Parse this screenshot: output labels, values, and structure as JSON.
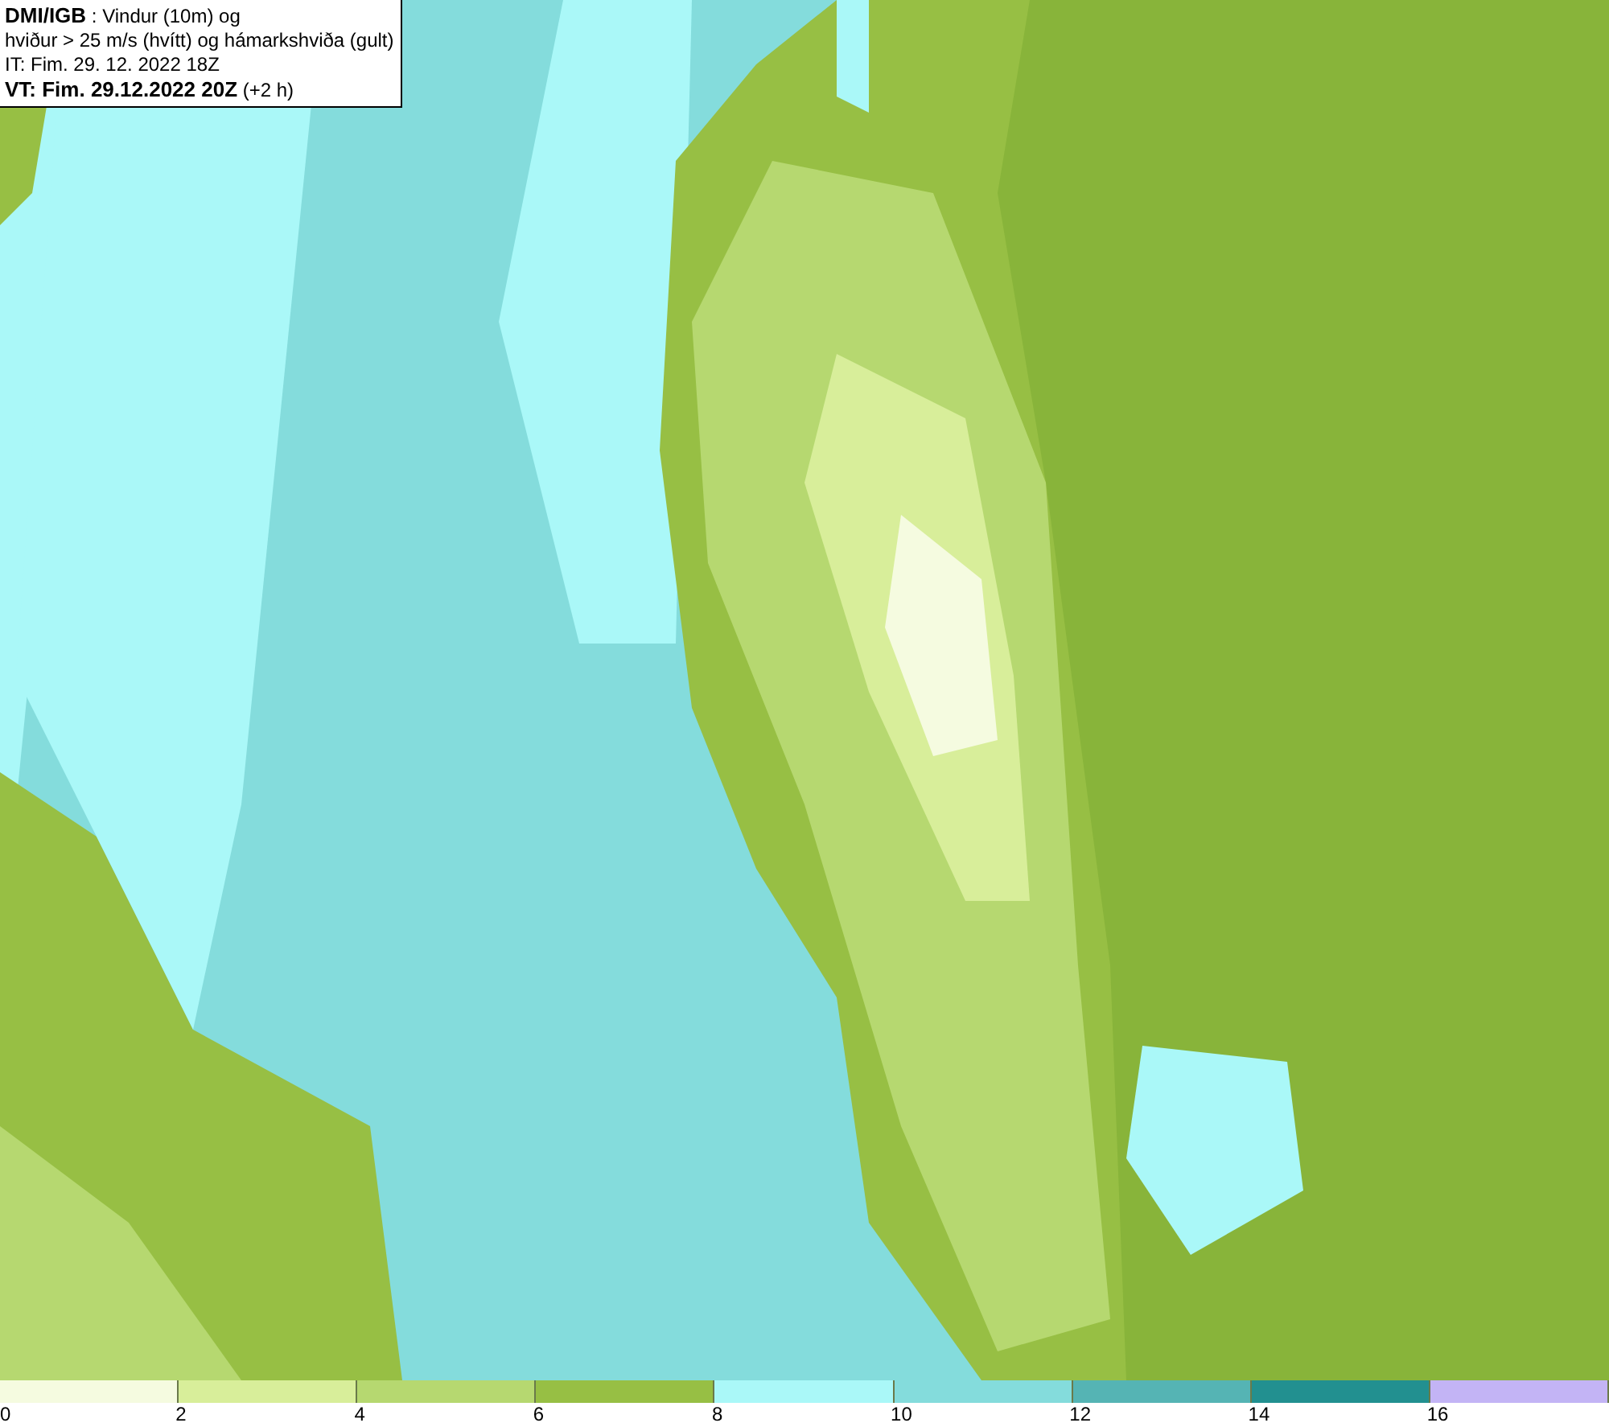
{
  "info_box": {
    "lines": [
      "**DMI/IGB** : Vindur (10m) og",
      "hviður > 25 m/s (hvítt) og hámarkshviða (gult)",
      "IT: Fim. 29. 12. 2022 18Z",
      "**VT: Fim. 29.12.2022 20Z** (+2 h)"
    ]
  },
  "legend": {
    "bins": [
      {
        "color": "#f5fbe0"
      },
      {
        "color": "#d8ee9a"
      },
      {
        "color": "#b6d870"
      },
      {
        "color": "#97bf44"
      },
      {
        "color": "#aaf8f8"
      },
      {
        "color": "#84dcdc"
      },
      {
        "color": "#55b4b4"
      },
      {
        "color": "#229090"
      },
      {
        "color": "#c3b4f5"
      }
    ],
    "labels": [
      "0",
      "2",
      "4",
      "6",
      "8",
      "10",
      "12",
      "14",
      "16"
    ]
  }
}
